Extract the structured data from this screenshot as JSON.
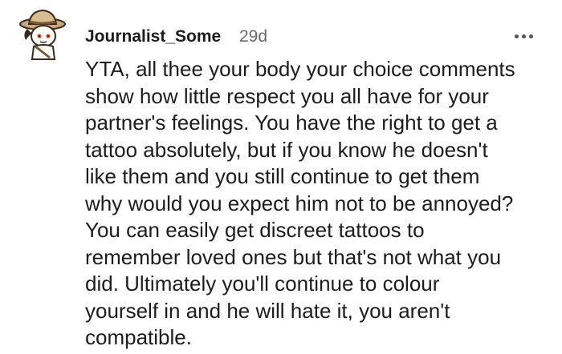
{
  "comment": {
    "author": "Journalist_Some",
    "age": "29d",
    "more_icon": "more-horizontal-icon",
    "avatar_icon": "explorer-avatar-icon",
    "text": "YTA, all thee your body your choice comments\nshow how little respect you all have for your\npartner's feelings. You have the right to get a\ntattoo absolutely, but if you know he doesn't\nlike them and you still continue to get them\nwhy would you expect him not to be annoyed?\nYou can easily get discreet tattoos to\nremember loved ones but that's not what you\ndid. Ultimately you'll continue to colour\nyourself in and he will hate it, you aren't\ncompatible."
  }
}
